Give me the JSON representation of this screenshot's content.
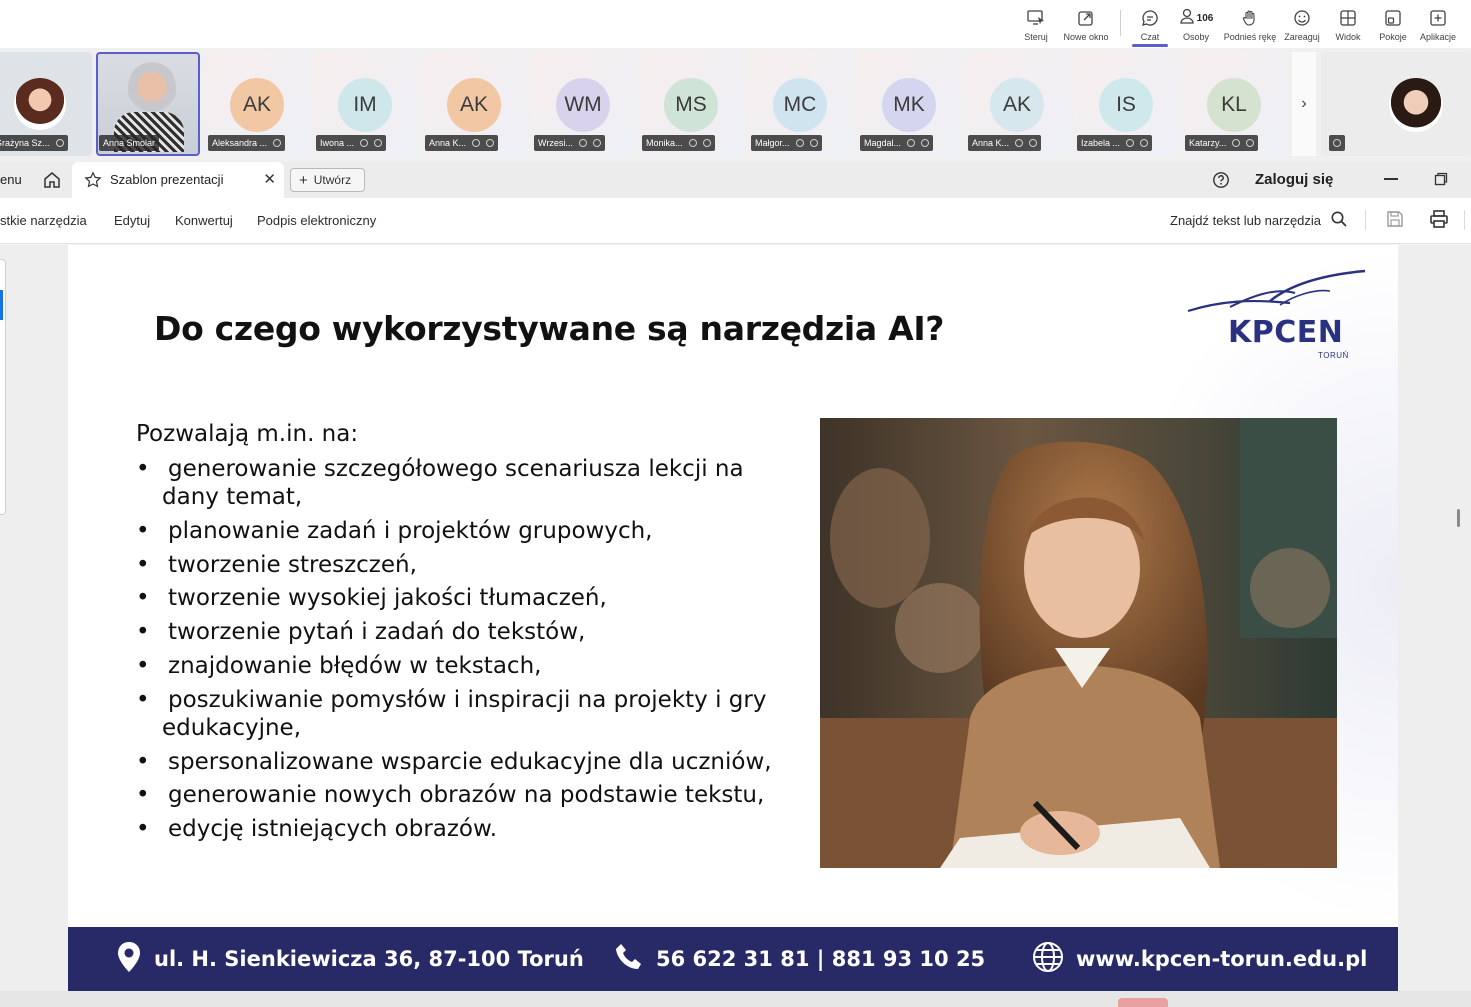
{
  "teams_toolbar": {
    "buttons": [
      {
        "label": "Steruj",
        "icon": "share-control-icon"
      },
      {
        "label": "Nowe okno",
        "icon": "pop-out-icon"
      },
      {
        "label": "Czat",
        "icon": "chat-icon"
      },
      {
        "label": "Osoby",
        "icon": "people-icon",
        "count": "106"
      },
      {
        "label": "Podnieś rękę",
        "icon": "raise-hand-icon"
      },
      {
        "label": "Zareaguj",
        "icon": "react-icon"
      },
      {
        "label": "Widok",
        "icon": "view-icon"
      },
      {
        "label": "Pokoje",
        "icon": "rooms-icon"
      },
      {
        "label": "Aplikacje",
        "icon": "apps-icon"
      }
    ],
    "accent_color": "#5b5fc7"
  },
  "participants": [
    {
      "name": "Grażyna Sz...",
      "initials": "",
      "type": "photo"
    },
    {
      "name": "Anna Smolar",
      "initials": "",
      "type": "video",
      "selected": true
    },
    {
      "name": "Aleksandra ...",
      "initials": "AK",
      "color": "#f2c7a4"
    },
    {
      "name": "Iwona ...",
      "initials": "IM",
      "color": "#cfe7ea"
    },
    {
      "name": "Anna K...",
      "initials": "AK",
      "color": "#f2c7a4"
    },
    {
      "name": "Wrzesi...",
      "initials": "WM",
      "color": "#d8d2ec"
    },
    {
      "name": "Monika...",
      "initials": "MS",
      "color": "#cfe3d6"
    },
    {
      "name": "Małgor...",
      "initials": "MC",
      "color": "#cfe4ee"
    },
    {
      "name": "Magdal...",
      "initials": "MK",
      "color": "#d3d6ee"
    },
    {
      "name": "Anna K...",
      "initials": "AK",
      "color": "#d6e7ee"
    },
    {
      "name": "Izabela ...",
      "initials": "IS",
      "color": "#cfe8ec"
    },
    {
      "name": "Katarzy...",
      "initials": "KL",
      "color": "#d5e2cf"
    }
  ],
  "acrobat": {
    "menu_fragment": "enu",
    "tab_title": "Szablon prezentacji",
    "create_label": "Utwórz",
    "login_label": "Zaloguj się",
    "menu_items": [
      "stkie narzędzia",
      "Edytuj",
      "Konwertuj",
      "Podpis elektroniczny"
    ],
    "find_label": "Znajdź tekst lub narzędzia"
  },
  "slide": {
    "title": "Do czego wykorzystywane są narzędzia AI?",
    "logo_text": "KPCEN",
    "logo_sub": "TORUŃ",
    "intro": "Pozwalają m.in. na:",
    "bullets": [
      {
        "l1": "generowanie szczegółowego scenariusza lekcji na",
        "l2": "dany temat,"
      },
      {
        "l1": "planowanie zadań i projektów grupowych,"
      },
      {
        "l1": "tworzenie streszczeń,"
      },
      {
        "l1": "tworzenie wysokiej jakości tłumaczeń,"
      },
      {
        "l1": "tworzenie pytań i zadań do tekstów,"
      },
      {
        "l1": "znajdowanie błędów w tekstach,"
      },
      {
        "l1": "poszukiwanie pomysłów i inspiracji na projekty i gry",
        "l2": "edukacyjne,"
      },
      {
        "l1": "spersonalizowane wsparcie edukacyjne dla uczniów,"
      },
      {
        "l1": "generowanie nowych obrazów na podstawie tekstu,"
      },
      {
        "l1": "edycję istniejących obrazów."
      }
    ],
    "footer": {
      "address": "ul. H. Sienkiewicza 36, 87-100 Toruń",
      "phone": "56 622 31 81 | 881 93 10 25",
      "web": "www.kpcen-torun.edu.pl"
    },
    "footer_color": "#282a68"
  }
}
